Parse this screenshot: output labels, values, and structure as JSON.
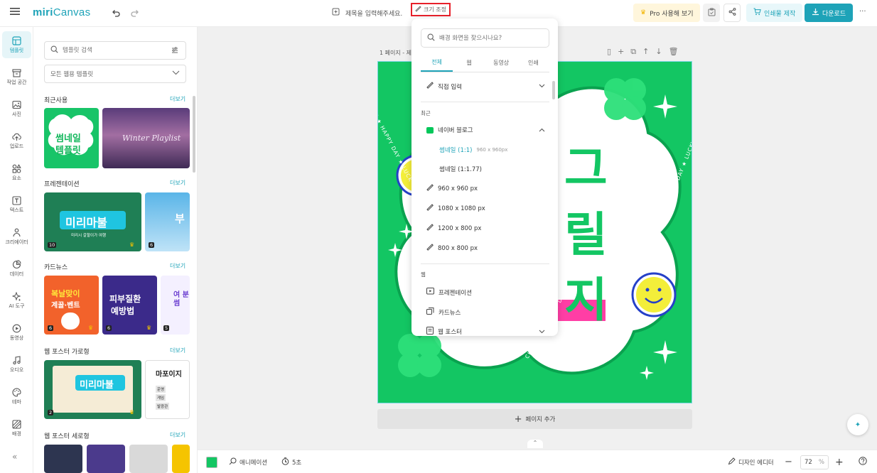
{
  "app": {
    "logo_prefix": "miri",
    "logo_suffix": "Canvas"
  },
  "topbar": {
    "doc_title": "제목을 입력해주세요.",
    "resize_label": "크기 조정",
    "pro_label": "Pro 사용해 보기",
    "print_label": "인쇄물 제작",
    "download_label": "다운로드",
    "more_label": "···"
  },
  "rail": {
    "items": [
      {
        "label": "템플릿",
        "icon": "template-icon"
      },
      {
        "label": "작업 공간",
        "icon": "workspace-icon"
      },
      {
        "label": "사진",
        "icon": "photo-icon"
      },
      {
        "label": "업로드",
        "icon": "upload-icon"
      },
      {
        "label": "요소",
        "icon": "elements-icon"
      },
      {
        "label": "텍스트",
        "icon": "text-icon"
      },
      {
        "label": "크리에이터",
        "icon": "creator-icon"
      },
      {
        "label": "데이터",
        "icon": "data-icon"
      },
      {
        "label": "AI 도구",
        "icon": "ai-icon"
      },
      {
        "label": "동영상",
        "icon": "video-icon"
      },
      {
        "label": "오디오",
        "icon": "audio-icon"
      },
      {
        "label": "테마",
        "icon": "palette-icon"
      },
      {
        "label": "배경",
        "icon": "background-icon"
      }
    ]
  },
  "panel": {
    "search_placeholder": "템플릿 검색",
    "filter_value": "모든 웹용 템플릿",
    "more_label": "더보기",
    "sections": [
      {
        "title": "최근사용"
      },
      {
        "title": "프레젠테이션"
      },
      {
        "title": "카드뉴스"
      },
      {
        "title": "웹 포스터 가로형"
      },
      {
        "title": "웹 포스터 세로형"
      }
    ],
    "thumbs": {
      "thumbnail_title_1": "썸네일",
      "thumbnail_title_2": "템플릿",
      "winter": "Winter Playlist",
      "pres_title": "미리마불",
      "pres_sub": "미리시 갈할이가 여행",
      "pres_badge": "10",
      "pres2_badge": "6",
      "pres2_text": "부",
      "card1_text1": "복날맞이",
      "card1_text2": "계꿀·벤트",
      "card1_badge": "6",
      "card2_text1": "피부질환",
      "card2_text2": "예방법",
      "card2_badge": "6",
      "card3_text": "여 분 썸",
      "card3_badge": "5",
      "poster1_title": "미리마불",
      "poster1_badge": "2",
      "poster2_title": "마포이지",
      "poster2_rows": [
        "운영",
        "게임",
        "발광관"
      ]
    }
  },
  "canvas": {
    "page_label": "1 페이지 - 제",
    "add_page_label": "페이지 추가",
    "design": {
      "big_text_1": "그",
      "big_text_2": "릴",
      "big_text_3": "지",
      "arc_text_top": "DAY ★ HAPPY DAY ★ LUCK",
      "arc_text_right": "HAPPY DAY ★ LUCKY D",
      "arc_text_bottom": "CKY DAY ★ PRETTY D"
    }
  },
  "bottombar": {
    "animation_label": "애니메이션",
    "duration_label": "5초",
    "editor_label": "디자인 에디터",
    "zoom_value": "72",
    "zoom_unit": "%"
  },
  "dropdown": {
    "search_placeholder": "배경 화면을 찾으시나요?",
    "tabs": [
      "전체",
      "웹",
      "동영상",
      "인쇄"
    ],
    "custom_label": "직접 입력",
    "recent_title": "최근",
    "naver_label": "네이버 블로그",
    "naver_options": [
      {
        "label": "썸네일 (1:1)",
        "size": "960 x 960px"
      },
      {
        "label": "썸네일 (1:1.77)",
        "size": ""
      }
    ],
    "size_items": [
      "960 x 960 px",
      "1080 x 1080 px",
      "1200 x 800 px",
      "800 x 800 px"
    ],
    "web_title": "웹",
    "web_items": [
      "프레젠테이션",
      "카드뉴스",
      "웹 포스터"
    ]
  },
  "colors": {
    "accent": "#1ea3b8",
    "canvas_green": "#13c663",
    "highlight_red": "#e8202a"
  }
}
